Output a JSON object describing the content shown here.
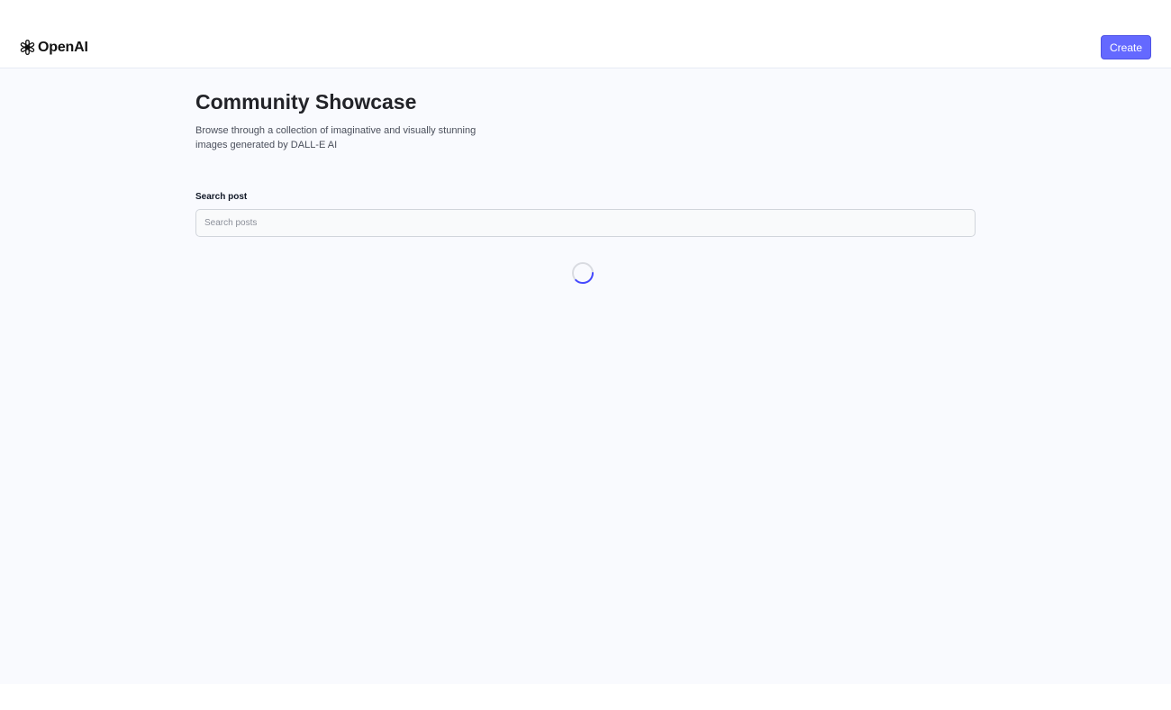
{
  "header": {
    "logo_text": "OpenAI",
    "create_label": "Create"
  },
  "main": {
    "title": "Community Showcase",
    "subtitle": "Browse through a collection of imaginative and visually stunning images generated by DALL-E AI",
    "search": {
      "label": "Search post",
      "placeholder": "Search posts",
      "value": ""
    },
    "loading": true
  },
  "icons": {
    "logo": "openai-logo-icon",
    "loader": "loading-spinner-icon"
  },
  "colors": {
    "accent": "#6469ff",
    "background": "#f9fafe",
    "title": "#222328"
  }
}
